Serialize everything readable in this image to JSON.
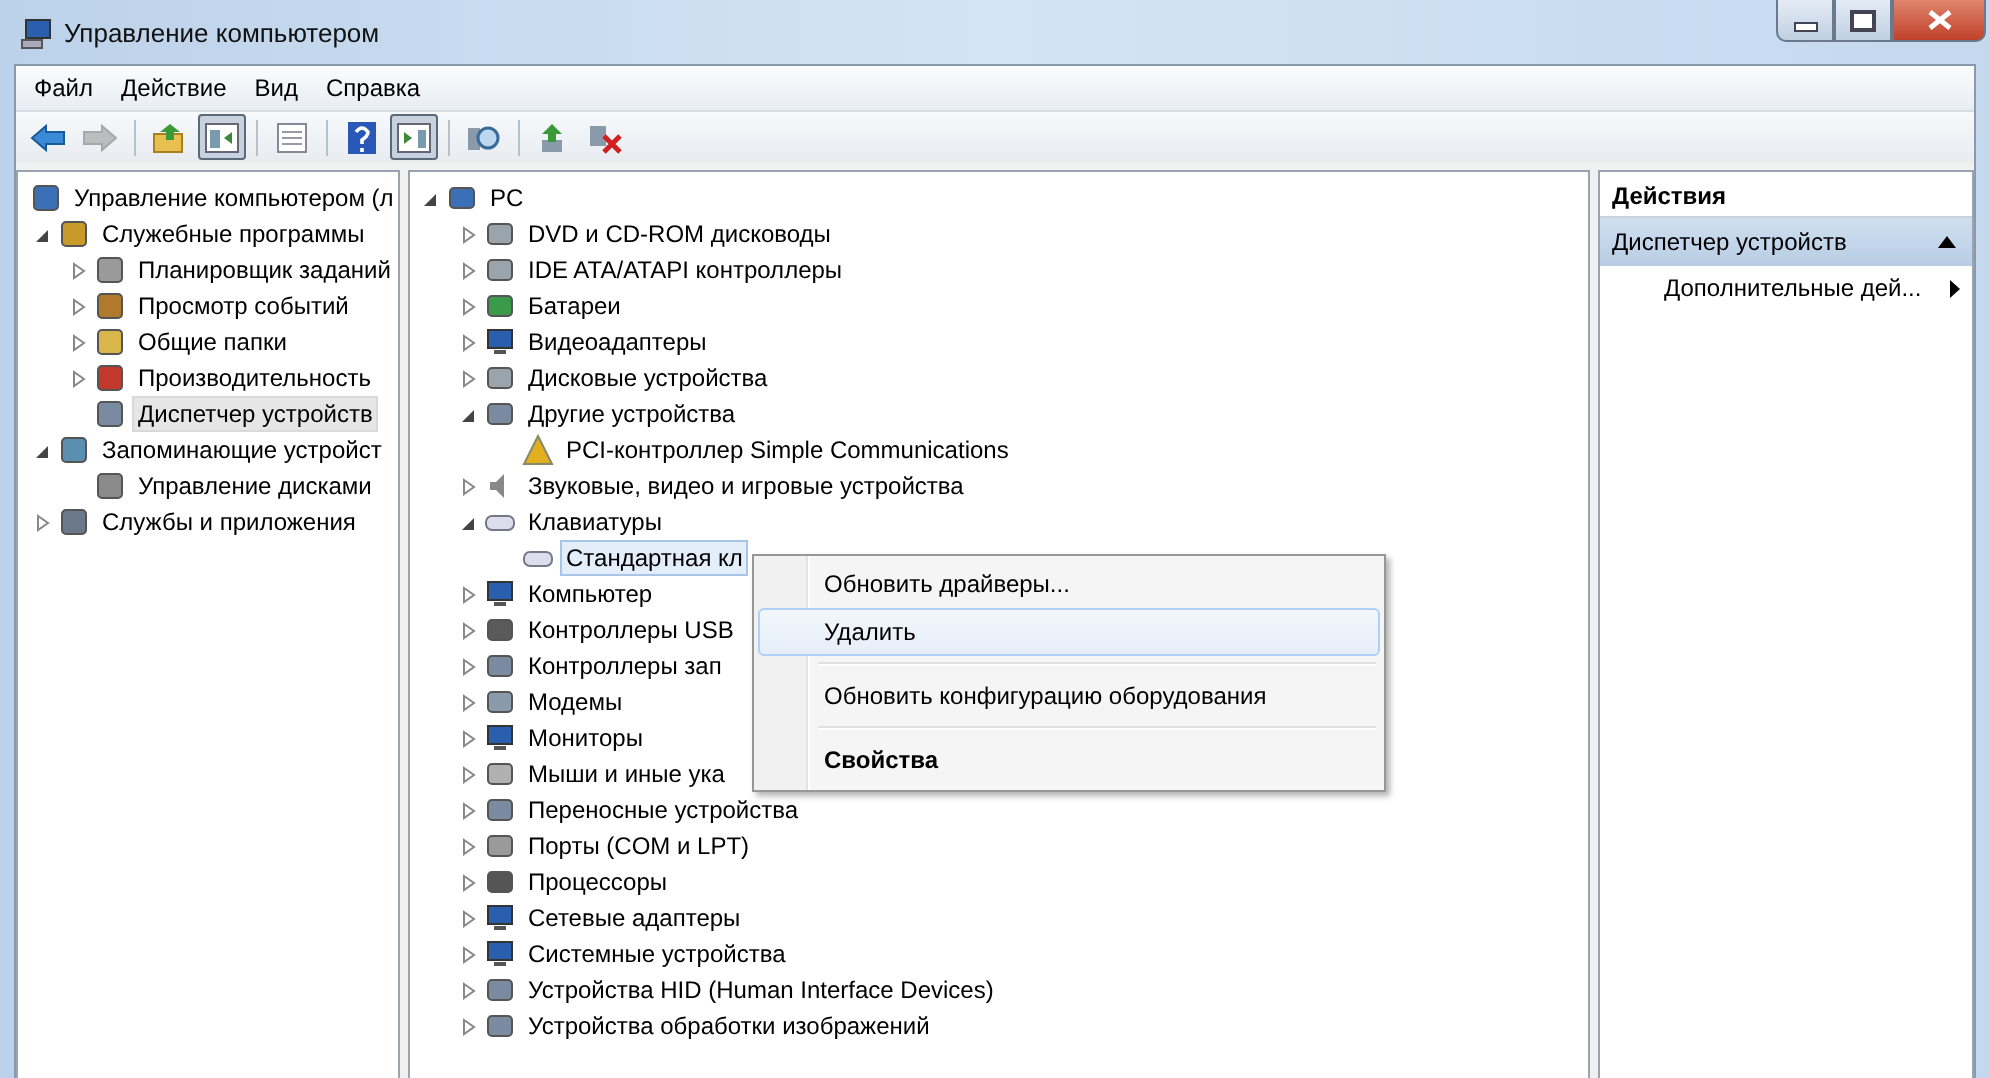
{
  "window": {
    "title": "Управление компьютером"
  },
  "menu": [
    "Файл",
    "Действие",
    "Вид",
    "Справка"
  ],
  "toolbar": [
    {
      "kind": "back",
      "pressed": false,
      "disabled": false
    },
    {
      "kind": "forward",
      "pressed": false,
      "disabled": true
    },
    {
      "kind": "separator"
    },
    {
      "kind": "up",
      "pressed": false,
      "disabled": false
    },
    {
      "kind": "tree",
      "pressed": true,
      "disabled": false
    },
    {
      "kind": "separator"
    },
    {
      "kind": "list",
      "pressed": false,
      "disabled": false
    },
    {
      "kind": "separator"
    },
    {
      "kind": "help",
      "pressed": false,
      "disabled": false
    },
    {
      "kind": "pane",
      "pressed": true,
      "disabled": false
    },
    {
      "kind": "separator"
    },
    {
      "kind": "scan",
      "pressed": false,
      "disabled": false
    },
    {
      "kind": "separator"
    },
    {
      "kind": "update",
      "pressed": false,
      "disabled": false
    },
    {
      "kind": "remove",
      "pressed": false,
      "disabled": false
    }
  ],
  "console_tree": {
    "label": "Управление компьютером (л",
    "selected": false,
    "children": [
      {
        "label": "Служебные программы",
        "expanded": true,
        "selected": false,
        "children": [
          {
            "label": "Планировщик заданий",
            "expanded": false,
            "selected": false
          },
          {
            "label": "Просмотр событий",
            "expanded": false,
            "selected": false
          },
          {
            "label": "Общие папки",
            "expanded": false,
            "selected": false
          },
          {
            "label": "Производительность",
            "expanded": false,
            "selected": false
          },
          {
            "label": "Диспетчер устройств",
            "selected": true
          }
        ]
      },
      {
        "label": "Запоминающие устройст",
        "expanded": true,
        "selected": false,
        "children": [
          {
            "label": "Управление дисками",
            "selected": false
          }
        ]
      },
      {
        "label": "Службы и приложения",
        "expanded": false,
        "selected": false
      }
    ]
  },
  "device_tree": {
    "label": "PC",
    "expanded": true,
    "selected": false,
    "children": [
      {
        "label": "DVD и CD-ROM дисководы",
        "expanded": false,
        "selected": false
      },
      {
        "label": "IDE ATA/ATAPI контроллеры",
        "expanded": false,
        "selected": false
      },
      {
        "label": "Батареи",
        "expanded": false,
        "selected": false
      },
      {
        "label": "Видеоадаптеры",
        "expanded": false,
        "selected": false
      },
      {
        "label": "Дисковые устройства",
        "expanded": false,
        "selected": false
      },
      {
        "label": "Другие устройства",
        "expanded": true,
        "selected": false,
        "children": [
          {
            "label": "PCI-контроллер Simple Communications",
            "selected": false
          }
        ]
      },
      {
        "label": "Звуковые, видео и игровые устройства",
        "expanded": false,
        "selected": false
      },
      {
        "label": "Клавиатуры",
        "expanded": true,
        "selected": false,
        "children": [
          {
            "label": "Стандартная кл",
            "selected": true
          }
        ]
      },
      {
        "label": "Компьютер",
        "expanded": false,
        "selected": false
      },
      {
        "label": "Контроллеры USB",
        "expanded": false,
        "selected": false
      },
      {
        "label": "Контроллеры зап",
        "expanded": false,
        "selected": false
      },
      {
        "label": "Модемы",
        "expanded": false,
        "selected": false
      },
      {
        "label": "Мониторы",
        "expanded": false,
        "selected": false
      },
      {
        "label": "Мыши и иные ука",
        "expanded": false,
        "selected": false
      },
      {
        "label": "Переносные устройства",
        "expanded": false,
        "selected": false
      },
      {
        "label": "Порты (COM и LPT)",
        "expanded": false,
        "selected": false
      },
      {
        "label": "Процессоры",
        "expanded": false,
        "selected": false
      },
      {
        "label": "Сетевые адаптеры",
        "expanded": false,
        "selected": false
      },
      {
        "label": "Системные устройства",
        "expanded": false,
        "selected": false
      },
      {
        "label": "Устройства HID (Human Interface Devices)",
        "expanded": false,
        "selected": false
      },
      {
        "label": "Устройства обработки изображений",
        "expanded": false,
        "selected": false
      }
    ]
  },
  "context_menu": {
    "items": [
      {
        "label": "Обновить драйверы...",
        "selected": false,
        "bold": false,
        "separator_after": false
      },
      {
        "label": "Удалить",
        "selected": true,
        "bold": false,
        "separator_after": true
      },
      {
        "label": "Обновить конфигурацию оборудования",
        "selected": false,
        "bold": false,
        "separator_after": true
      },
      {
        "label": "Свойства",
        "selected": false,
        "bold": true,
        "separator_after": false
      }
    ]
  },
  "actions": {
    "title": "Действия",
    "section": {
      "label": "Диспетчер устройств",
      "expanded": true
    },
    "items": [
      {
        "label": "Дополнительные дей..."
      }
    ]
  }
}
